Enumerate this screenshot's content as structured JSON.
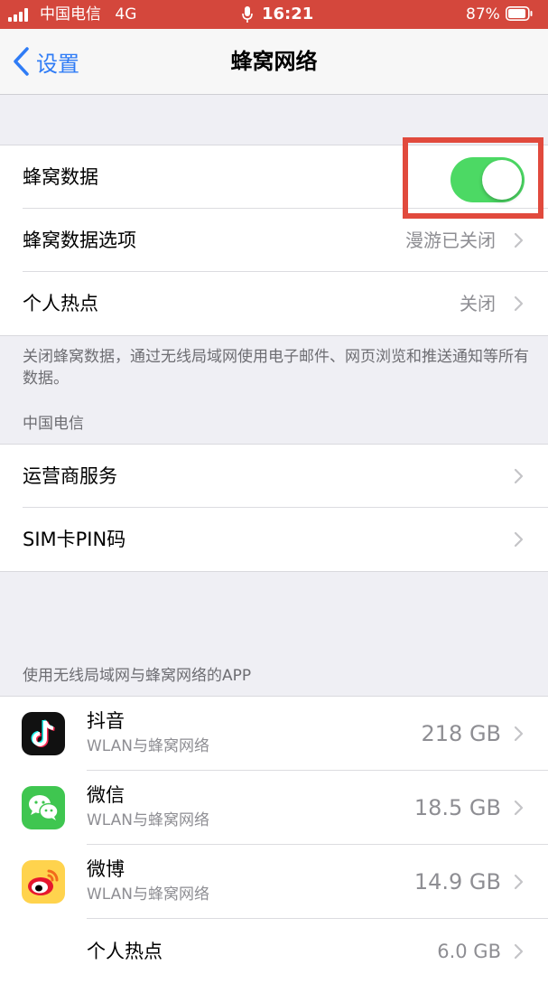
{
  "status_bar": {
    "carrier": "中国电信",
    "network": "4G",
    "time": "16:21",
    "battery": "87%"
  },
  "nav": {
    "back_label": "设置",
    "title": "蜂窝网络"
  },
  "settings": {
    "cellular_data_label": "蜂窝数据",
    "cellular_data_on": true,
    "options_label": "蜂窝数据选项",
    "options_value": "漫游已关闭",
    "hotspot_label": "个人热点",
    "hotspot_value": "关闭"
  },
  "footnote": "关闭蜂窝数据，通过无线局域网使用电子邮件、网页浏览和推送通知等所有数据。",
  "carrier_section": {
    "header": "中国电信",
    "carrier_services": "运营商服务",
    "sim_pin": "SIM卡PIN码"
  },
  "apps_section": {
    "header": "使用无线局域网与蜂窝网络的APP",
    "apps": [
      {
        "name": "抖音",
        "sub": "WLAN与蜂窝网络",
        "usage": "218 GB",
        "icon": "douyin-icon"
      },
      {
        "name": "微信",
        "sub": "WLAN与蜂窝网络",
        "usage": "18.5 GB",
        "icon": "wechat-icon"
      },
      {
        "name": "微博",
        "sub": "WLAN与蜂窝网络",
        "usage": "14.9 GB",
        "icon": "weibo-icon"
      },
      {
        "name": "个人热点",
        "usage": "6.0 GB"
      }
    ]
  },
  "colors": {
    "status_bar": "#d4473c",
    "accent": "#2f7cf6",
    "toggle_on": "#4cd964",
    "highlight": "#e14a3d"
  }
}
